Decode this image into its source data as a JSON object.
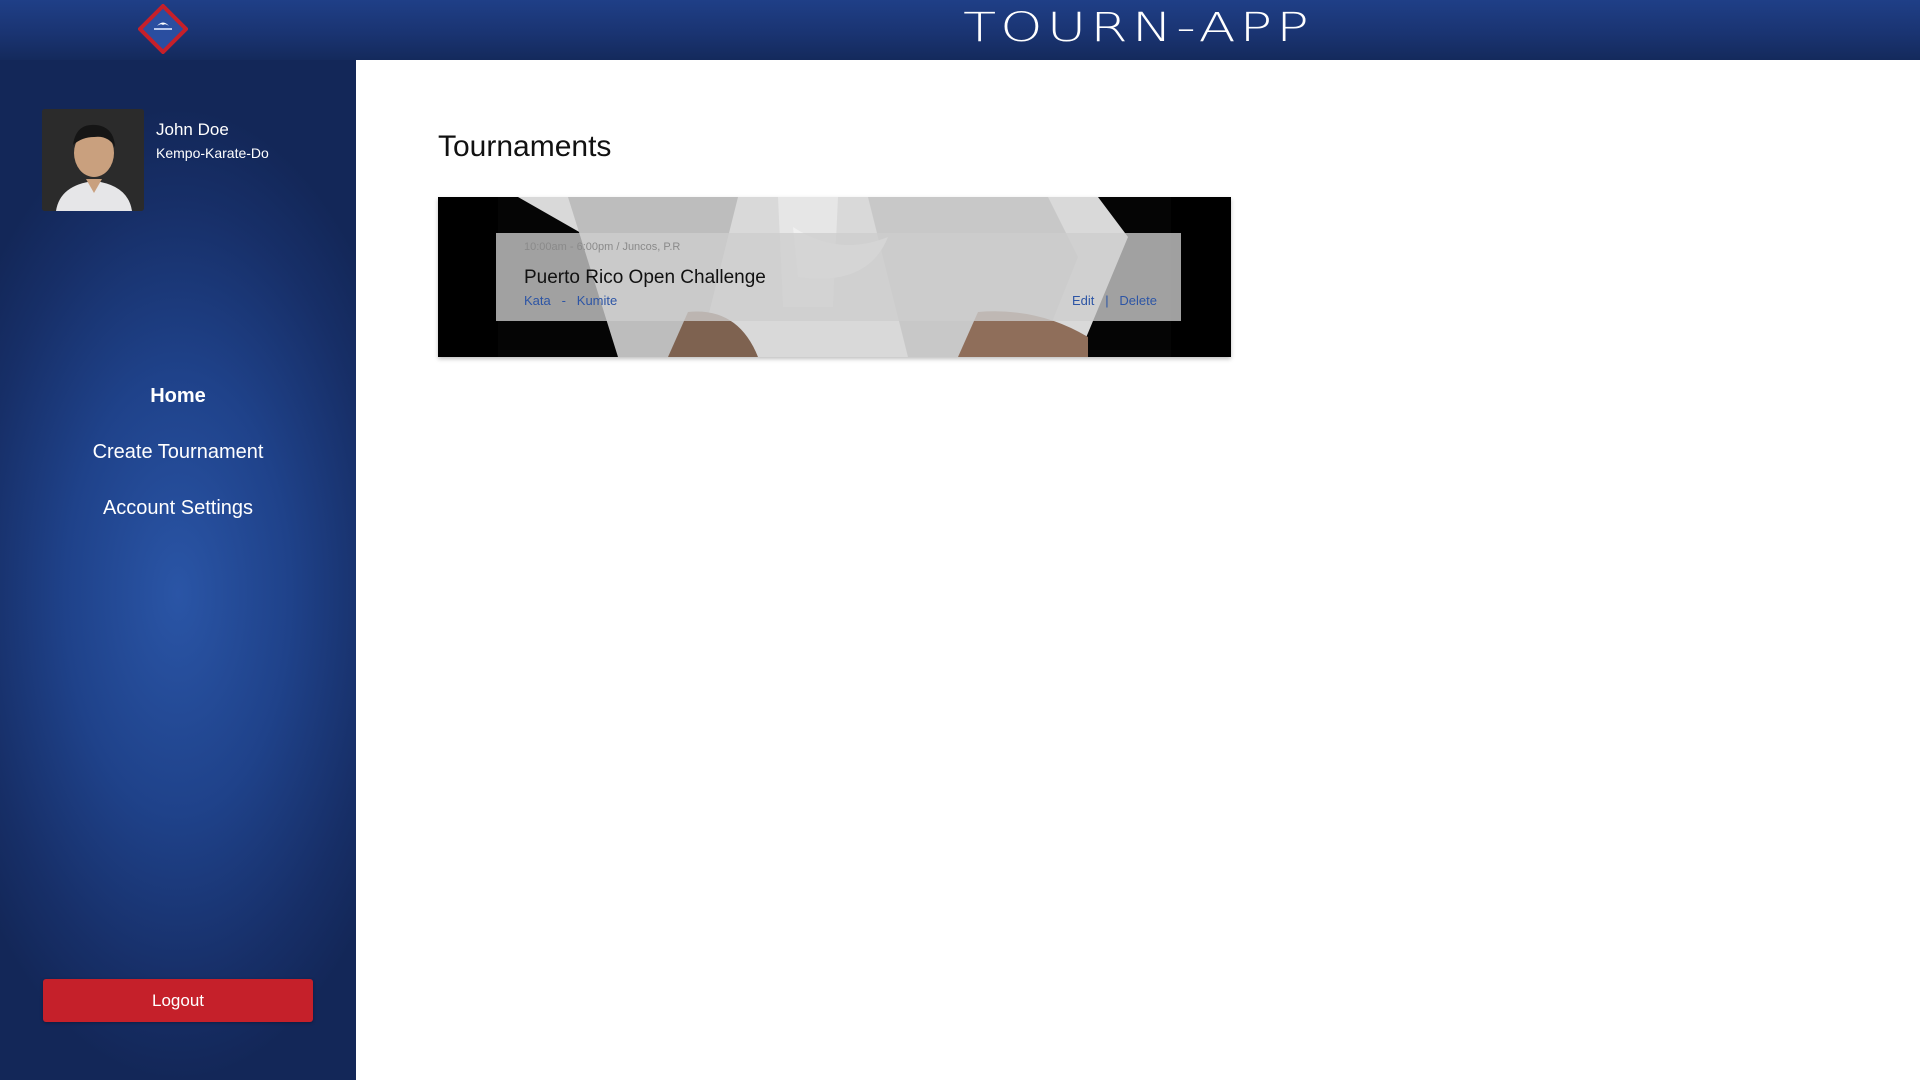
{
  "header": {
    "app_title": "TOURN-APP",
    "logo_icon": "diamond-logo-icon",
    "colors": {
      "bar": "#1a3472",
      "logo_border": "#c5202a"
    }
  },
  "sidebar": {
    "profile": {
      "name": "John Doe",
      "club": "Kempo-Karate-Do"
    },
    "nav": [
      {
        "label": "Home",
        "active": true
      },
      {
        "label": "Create Tournament",
        "active": false
      },
      {
        "label": "Account Settings",
        "active": false
      }
    ],
    "logout_label": "Logout",
    "colors": {
      "logout": "#c5202a",
      "background": "#1f428a"
    }
  },
  "main": {
    "title": "Tournaments",
    "tournaments": [
      {
        "meta": "10:00am - 6:00pm / Juncos, P.R",
        "name": "Puerto Rico Open Challenge",
        "categories": [
          "Kata",
          "Kumite"
        ],
        "category_separator": "-",
        "actions": [
          "Edit",
          "Delete"
        ],
        "action_separator": "|"
      }
    ]
  }
}
